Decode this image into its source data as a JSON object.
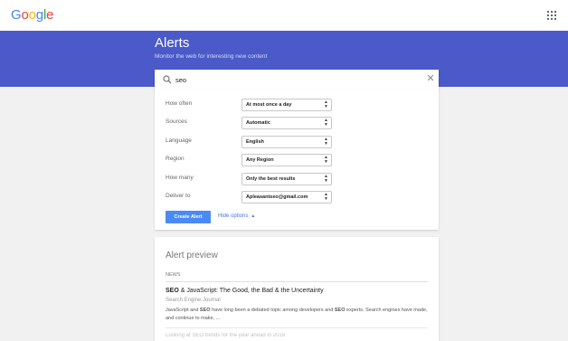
{
  "header": {
    "logo": [
      "G",
      "o",
      "o",
      "g",
      "l",
      "e"
    ],
    "logo_colors": [
      "#4285f4",
      "#ea4335",
      "#fbbc05",
      "#4285f4",
      "#34a853",
      "#ea4335"
    ],
    "apps_icon": "apps-grid-icon"
  },
  "hero": {
    "title": "Alerts",
    "subtitle": "Monitor the web for interesting new content",
    "bg_color": "#4b5ac8"
  },
  "search": {
    "icon": "search-icon",
    "value": "seo",
    "clear_icon": "close-icon"
  },
  "options": [
    {
      "label": "How often",
      "value": "At most once a day"
    },
    {
      "label": "Sources",
      "value": "Automatic"
    },
    {
      "label": "Language",
      "value": "English"
    },
    {
      "label": "Region",
      "value": "Any Region"
    },
    {
      "label": "How many",
      "value": "Only the best results"
    },
    {
      "label": "Deliver to",
      "value": "Apleasantseo@gmail.com"
    }
  ],
  "actions": {
    "create_label": "Create Alert",
    "hide_label": "Hide options",
    "accent_color": "#4a8af4"
  },
  "preview": {
    "title": "Alert preview",
    "category": "NEWS",
    "article": {
      "title_bold": "SEO",
      "title_rest": " & JavaScript: The Good, the Bad & the Uncertainty",
      "source": "Search Engine Journal",
      "snippet_1": "JavaScript and ",
      "snippet_b1": "SEO",
      "snippet_2": " have long been a debated topic among developers and ",
      "snippet_b2": "SEO",
      "snippet_3": " experts. Search engines have made, and continue to make, ..."
    },
    "next_article": "Looking at SEO trends for the year ahead in 2018"
  }
}
